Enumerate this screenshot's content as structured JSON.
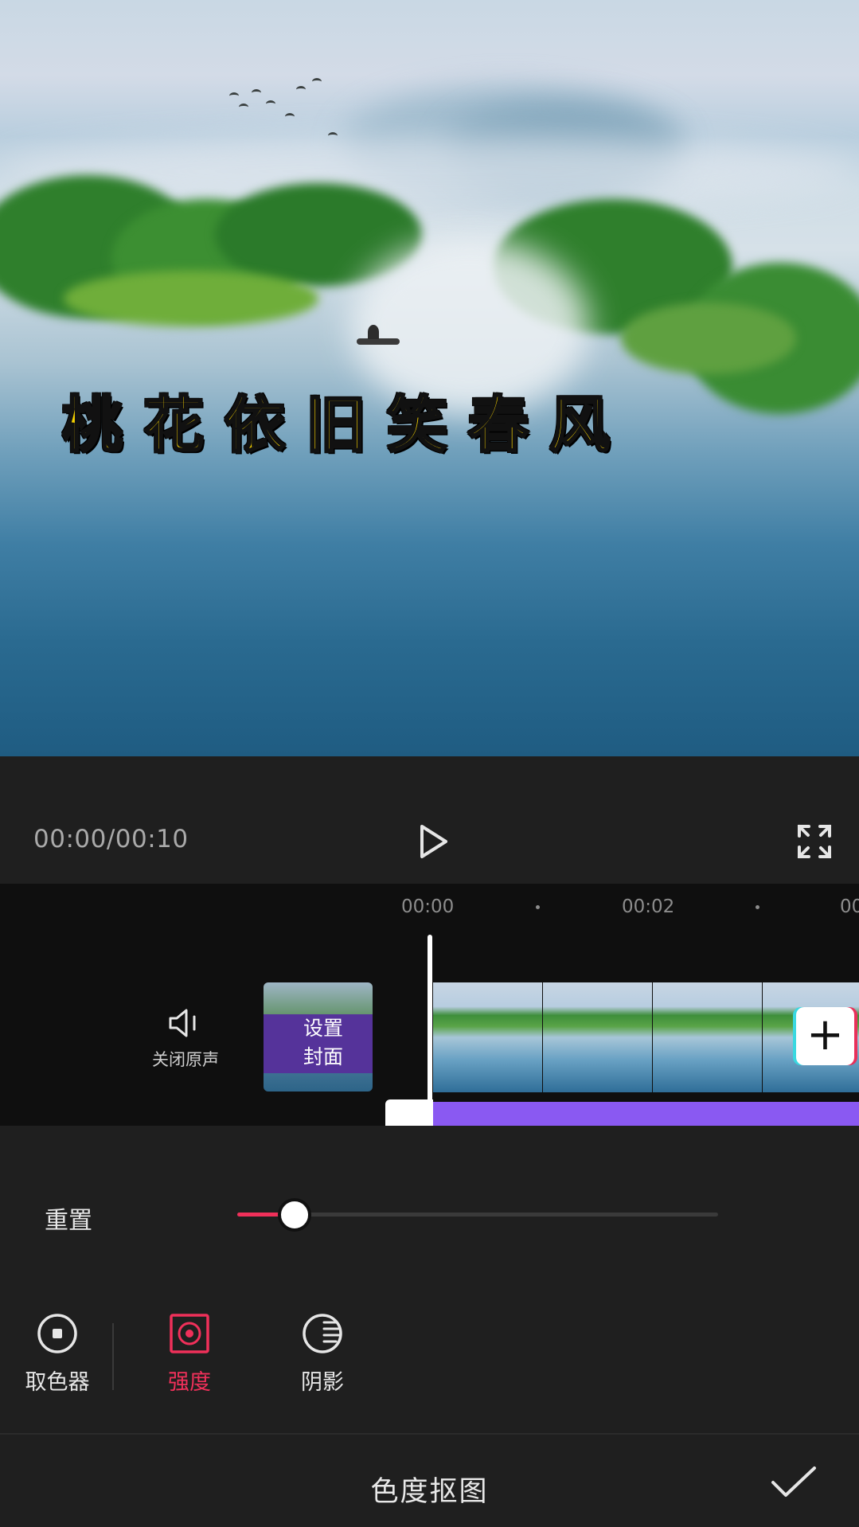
{
  "preview": {
    "subtitle": "桃花依旧笑春风"
  },
  "player": {
    "time": "00:00/00:10",
    "play_icon": "play-icon",
    "fullscreen_icon": "fullscreen-icon"
  },
  "timeline": {
    "ruler": [
      "00:00",
      "00:02",
      "00"
    ],
    "mute_label": "关闭原声",
    "cover_line1": "设置",
    "cover_line2": "封面",
    "add_icon": "+"
  },
  "adjust": {
    "reset_label": "重置",
    "slider_value": 0.12,
    "tools": [
      {
        "label": "取色器",
        "icon": "color-picker-icon",
        "active": false
      },
      {
        "label": "强度",
        "icon": "intensity-icon",
        "active": true
      },
      {
        "label": "阴影",
        "icon": "shadow-icon",
        "active": false
      }
    ]
  },
  "bottom": {
    "title": "色度抠图"
  },
  "colors": {
    "accent": "#f0305a",
    "audio_track": "#8a59f2",
    "subtitle": "#f6d200"
  }
}
